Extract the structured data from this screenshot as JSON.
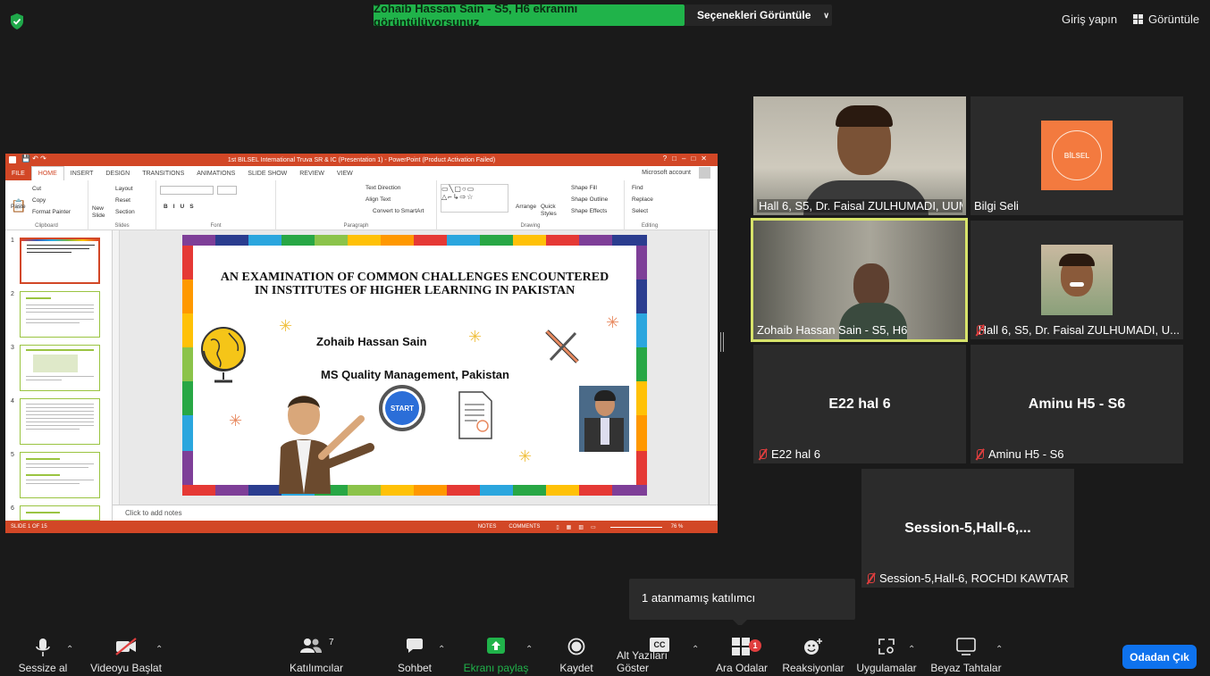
{
  "top": {
    "share_banner": "Zohaib Hassan Sain - S5, H6 ekranını görüntülüyorsunuz",
    "view_options": "Seçenekleri Görüntüle",
    "signin": "Giriş yapın",
    "view": "Görüntüle"
  },
  "powerpoint": {
    "title": "1st BILSEL International Truva SR & IC (Presentation 1) - PowerPoint (Product Activation Failed)",
    "account": "Microsoft account",
    "tabs": [
      "FILE",
      "HOME",
      "INSERT",
      "DESIGN",
      "TRANSITIONS",
      "ANIMATIONS",
      "SLIDE SHOW",
      "REVIEW",
      "VIEW"
    ],
    "groups": {
      "clipboard": "Clipboard",
      "slides": "Slides",
      "font": "Font",
      "paragraph": "Paragraph",
      "drawing": "Drawing",
      "editing": "Editing"
    },
    "ribbon": {
      "cut": "Cut",
      "copy": "Copy",
      "paste": "Paste",
      "format_painter": "Format Painter",
      "new_slide": "New Slide",
      "layout": "Layout",
      "reset": "Reset",
      "section": "Section",
      "text_direction": "Text Direction",
      "align_text": "Align Text",
      "convert_smartart": "Convert to SmartArt",
      "arrange": "Arrange",
      "quick_styles": "Quick Styles",
      "shape_fill": "Shape Fill",
      "shape_outline": "Shape Outline",
      "shape_effects": "Shape Effects",
      "find": "Find",
      "replace": "Replace",
      "select": "Select"
    },
    "slide": {
      "title": "AN EXAMINATION OF COMMON CHALLENGES ENCOUNTERED IN INSTITUTES OF HIGHER LEARNING IN PAKISTAN",
      "author": "Zohaib Hassan Sain",
      "affiliation": "MS Quality Management, Pakistan",
      "start": "START"
    },
    "thumb_numbers": [
      "1",
      "2",
      "3",
      "4",
      "5",
      "6"
    ],
    "notes": "Click to add notes",
    "status": "SLIDE 1 OF 15",
    "status_notes": "NOTES",
    "status_comments": "COMMENTS",
    "zoom": "76 %"
  },
  "participants": [
    {
      "name": "Hall 6, S5, Dr. Faisal ZULHUMADI, UUM"
    },
    {
      "name": "Bilgi Seli"
    },
    {
      "name": "Zohaib Hassan Sain - S5, H6"
    },
    {
      "name": "Hall 6, S5, Dr. Faisal ZULHUMADI, U..."
    },
    {
      "name": "E22 hal 6",
      "center": "E22 hal 6"
    },
    {
      "name": "Aminu H5 - S6",
      "center": "Aminu H5 - S6"
    },
    {
      "name": "Session-5,Hall-6, ROCHDI KAWTAR",
      "center": "Session-5,Hall-6,..."
    }
  ],
  "tooltip": "1 atanmamış katılımcı",
  "toolbar": {
    "mute": "Sessize al",
    "video": "Videoyu Başlat",
    "participants": "Katılımcılar",
    "participants_count": "7",
    "chat": "Sohbet",
    "share": "Ekranı paylaş",
    "record": "Kaydet",
    "captions": "Alt Yazıları Göster",
    "captions_icon_text": "CC",
    "breakout": "Ara Odalar",
    "breakout_badge": "1",
    "reactions": "Reaksiyonlar",
    "apps": "Uygulamalar",
    "whiteboard": "Beyaz Tahtalar",
    "leave": "Odadan Çık"
  },
  "colors": {
    "share_green": "#20b34a",
    "ppt_orange": "#d24726",
    "active_speaker": "#d7e36a",
    "leave_blue": "#0e72ed",
    "muted_red": "#e03e3e"
  }
}
